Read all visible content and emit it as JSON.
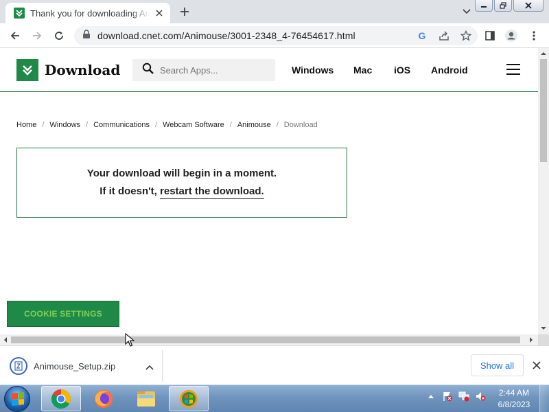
{
  "browser": {
    "tab_title": "Thank you for downloading Animouse",
    "url": "download.cnet.com/Animouse/3001-2348_4-76454617.html",
    "google_glyph": "G"
  },
  "site": {
    "logo_text": "Download",
    "search_placeholder": "Search Apps...",
    "nav": [
      "Windows",
      "Mac",
      "iOS",
      "Android"
    ]
  },
  "breadcrumb": [
    "Home",
    "Windows",
    "Communications",
    "Webcam Software",
    "Animouse",
    "Download"
  ],
  "breadcrumb_separator": "/",
  "download_box": {
    "line1": "Your download will begin in a moment.",
    "line2_prefix": "If it doesn't,",
    "restart_link": "restart the download."
  },
  "cookie_button": "COOKIE SETTINGS",
  "download_shelf": {
    "file_name": "Animouse_Setup.zip",
    "show_all": "Show all"
  },
  "taskbar": {
    "time": "2:44 AM",
    "date": "6/8/2023",
    "apps": [
      "chrome-icon",
      "firefox-icon",
      "file-explorer-icon",
      "windows-media-icon"
    ]
  },
  "colors": {
    "brand_green": "#1f8a47",
    "cookie_text": "#7fce5a",
    "show_all_blue": "#1a73e8"
  }
}
